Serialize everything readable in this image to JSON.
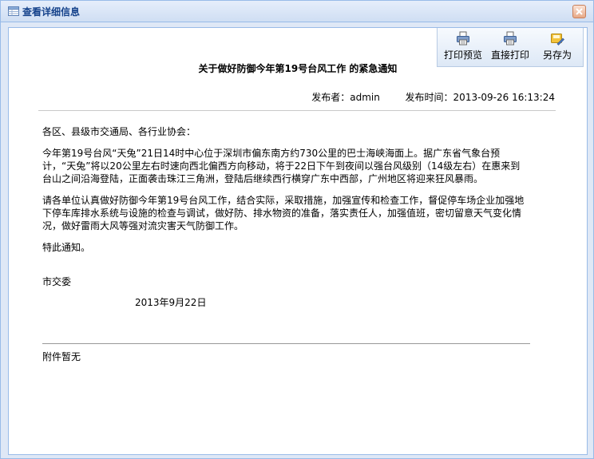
{
  "window": {
    "title": "查看详细信息"
  },
  "toolbar": {
    "print_preview_label": "打印预览",
    "print_direct_label": "直接打印",
    "save_as_label": "另存为"
  },
  "document": {
    "title": "关于做好防御今年第19号台风工作 的紧急通知",
    "publisher_label": "发布者：",
    "publisher": "admin",
    "publish_time_label": "发布时间：",
    "publish_time": "2013-09-26 16:13:24",
    "salutation": "各区、县级市交通局、各行业协会：",
    "paragraph1": "今年第19号台风“天兔”21日14时中心位于深圳市偏东南方约730公里的巴士海峡海面上。据广东省气象台预计，“天兔”将以20公里左右时速向西北偏西方向移动，将于22日下午到夜间以强台风级别（14级左右）在惠来到台山之间沿海登陆，正面袭击珠江三角洲，登陆后继续西行横穿广东中西部，广州地区将迎来狂风暴雨。",
    "paragraph2": "请各单位认真做好防御今年第19号台风工作，结合实际，采取措施，加强宣传和检查工作，督促停车场企业加强地下停车库排水系统与设施的检查与调试，做好防、排水物资的准备，落实责任人，加强值班，密切留意天气变化情况，做好雷雨大风等强对流灾害天气防御工作。",
    "closing": "特此通知。",
    "signer": "市交委",
    "date": "2013年9月22日",
    "attachment": "附件暂无"
  },
  "icons": {
    "window_icon": "table-icon",
    "close": "close-icon",
    "print_preview": "printer-icon",
    "print_direct": "printer-icon",
    "save_as": "save-as-icon"
  }
}
